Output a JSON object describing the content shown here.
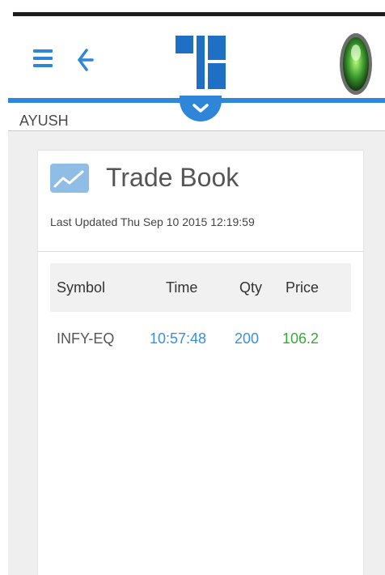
{
  "header": {
    "menu_icon": "hamburger-menu-icon",
    "back_icon": "back-arrow-icon",
    "logo_icon": "brand-logo",
    "avatar_icon": "profile-avatar",
    "dropdown_icon": "chevron-down-icon",
    "accent_color": "#2f86d8"
  },
  "user": {
    "name": "AYUSH"
  },
  "trade_book": {
    "title": "Trade Book",
    "icon": "chart-line-icon",
    "last_updated": "Last Updated Thu Sep 10 2015 12:19:59",
    "columns": [
      "Symbol",
      "Time",
      "Qty",
      "Price"
    ],
    "rows": [
      {
        "symbol": "INFY-EQ",
        "time": "10:57:48",
        "qty": "200",
        "price": "106.2"
      }
    ],
    "colors": {
      "time": "#3b8fe0",
      "qty": "#3b8fe0",
      "price": "#3aa83a"
    }
  }
}
